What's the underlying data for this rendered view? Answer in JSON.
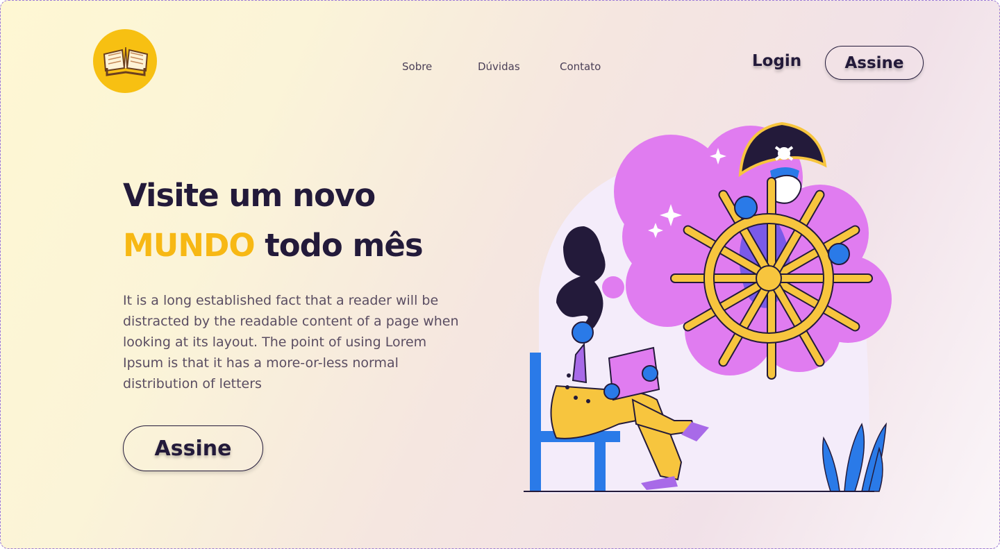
{
  "nav": {
    "items": [
      {
        "label": "Sobre"
      },
      {
        "label": "Dúvidas"
      },
      {
        "label": "Contato"
      }
    ],
    "login_label": "Login",
    "subscribe_label": "Assine"
  },
  "hero": {
    "title_line1": "Visite um novo",
    "title_accent": "MUNDO",
    "title_line2_rest": " todo mês",
    "paragraph": "It is a long established fact that a reader will be distracted by the readable content of a page when looking at its layout. The point of using Lorem Ipsum is that it has a more-or-less normal distribution of letters",
    "cta_label": "Assine"
  },
  "icons": {
    "logo": "open-book-icon"
  },
  "colors": {
    "accent": "#f7b814",
    "text_dark": "#231a3a",
    "logo_bg": "#f7c012",
    "cloud": "#e07cf0",
    "blue": "#2a7ae8"
  }
}
